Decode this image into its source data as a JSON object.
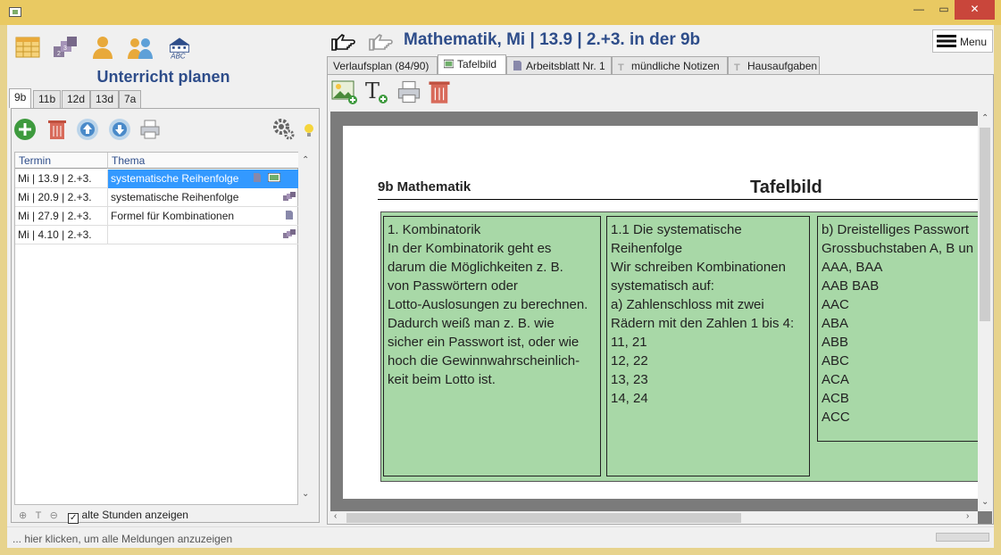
{
  "window": {
    "min_label": "—",
    "max_label": "▭",
    "close_label": "✕"
  },
  "left": {
    "title": "Unterricht planen",
    "class_tabs": [
      "9b",
      "11b",
      "12d",
      "13d",
      "7a"
    ],
    "table": {
      "headers": [
        "Termin",
        "Thema"
      ],
      "rows": [
        {
          "termin": "Mi | 13.9 | 2.+3.",
          "thema": "systematische Reihenfolge",
          "selected": true
        },
        {
          "termin": "Mi | 20.9 | 2.+3.",
          "thema": "systematische Reihenfolge",
          "selected": false
        },
        {
          "termin": "Mi | 27.9 | 2.+3.",
          "thema": "Formel für Kombinationen",
          "selected": false
        },
        {
          "termin": "Mi | 4.10 | 2.+3.",
          "thema": "",
          "selected": false
        }
      ]
    },
    "show_old_label": "alte Stunden anzeigen",
    "show_old_checked": "✓"
  },
  "right": {
    "lesson_title": "Mathematik, Mi  |  13.9  |  2.+3. in der 9b",
    "menu_label": "Menu",
    "tabs": [
      {
        "label": "Verlaufsplan (84/90)",
        "icon": "none"
      },
      {
        "label": "Tafelbild",
        "icon": "board-icon"
      },
      {
        "label": "Arbeitsblatt Nr. 1",
        "icon": "document-icon"
      },
      {
        "label": "mündliche Notizen",
        "icon": "text-icon"
      },
      {
        "label": "Hausaufgaben",
        "icon": "text-icon"
      }
    ],
    "active_tab": "Tafelbild"
  },
  "document": {
    "heading": "9b Mathematik",
    "title": "Tafelbild",
    "columns": [
      "1. Kombinatorik\nIn der Kombinatorik geht es\ndarum die Möglichkeiten z. B.\nvon Passwörtern oder\nLotto-Auslosungen zu berechnen.\nDadurch weiß man z. B. wie\nsicher ein Passwort ist, oder wie\nhoch die Gewinnwahrscheinlich-\nkeit beim Lotto ist.",
      "1.1 Die systematische\nReihenfolge\nWir schreiben Kombinationen\nsystematisch auf:\na) Zahlenschloss mit zwei\nRädern mit den Zahlen 1 bis 4:\n11, 21\n12, 22\n13, 23\n14, 24",
      "b) Dreistelliges Passwort\nGrossbuchstaben A, B un\nAAA,  BAA\nAAB   BAB\nAAC\nABA\nABB\nABC\nACA\nACB\nACC"
    ],
    "background_color": "#a8d8a7"
  },
  "statusbar": {
    "text": "... hier klicken, um alle Meldungen anzuzeigen"
  },
  "colors": {
    "accent": "#2e4d8a",
    "selection": "#3399ff",
    "title_bar": "#e9c962"
  }
}
